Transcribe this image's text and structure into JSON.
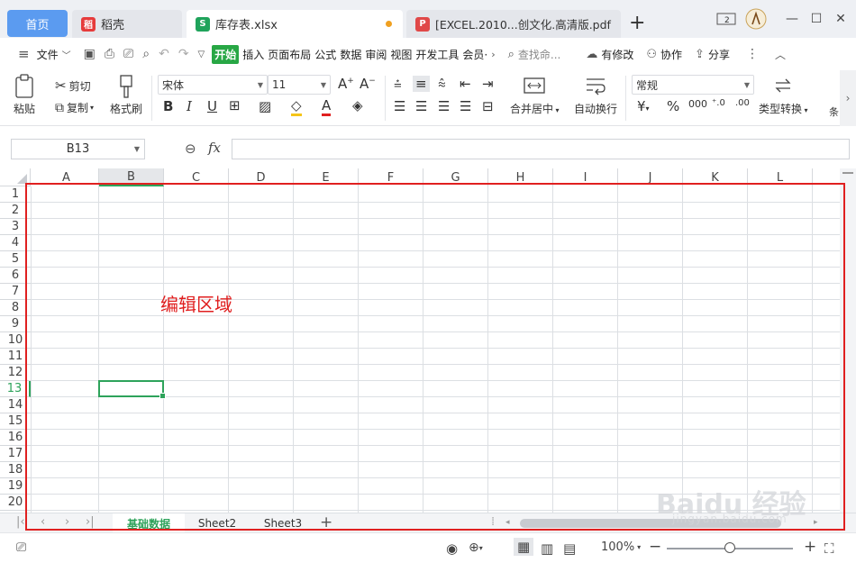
{
  "tabs": {
    "home": "首页",
    "daoke": "稻壳",
    "file": "库存表.xlsx",
    "pdf": "[EXCEL.2010...创文化.高清版.pdf"
  },
  "title_right": {
    "badge": "2"
  },
  "menu": {
    "file": "文件",
    "items": [
      "开始",
      "插入",
      "页面布局",
      "公式",
      "数据",
      "审阅",
      "视图",
      "开发工具",
      "会员·"
    ],
    "active_index": 0,
    "search_placeholder": "查找命...",
    "modify": "有修改",
    "collab": "协作",
    "share": "分享"
  },
  "ribbon": {
    "paste": "粘贴",
    "cut": "剪切",
    "copy": "复制",
    "format_painter": "格式刷",
    "font_name": "宋体",
    "font_size": "11",
    "merge_center": "合并居中",
    "wrap_text": "自动换行",
    "number_format": "常规",
    "type_convert": "类型转换",
    "more": "条"
  },
  "formula_bar": {
    "name_box": "B13",
    "fx": "fx",
    "value": ""
  },
  "grid": {
    "columns": [
      "A",
      "B",
      "C",
      "D",
      "E",
      "F",
      "G",
      "H",
      "I",
      "J",
      "K",
      "L"
    ],
    "rows": [
      "1",
      "2",
      "3",
      "4",
      "5",
      "6",
      "7",
      "8",
      "9",
      "10",
      "11",
      "12",
      "13",
      "14",
      "15",
      "16",
      "17",
      "18",
      "19",
      "20"
    ],
    "selected_col": "B",
    "selected_row": "13"
  },
  "sheets": [
    "基础数据",
    "Sheet2",
    "Sheet3"
  ],
  "active_sheet": 0,
  "status": {
    "zoom": "100%",
    "zoom_fraction": 0.5
  },
  "annotation": {
    "label": "编辑区域",
    "color": "#e02020"
  },
  "watermark": {
    "brand": "Baidu 经验",
    "url": "jingyan.baidu.com"
  },
  "colors": {
    "accent": "#2ea35b",
    "home_tab": "#5b9bf0",
    "annotation": "#e02020"
  }
}
